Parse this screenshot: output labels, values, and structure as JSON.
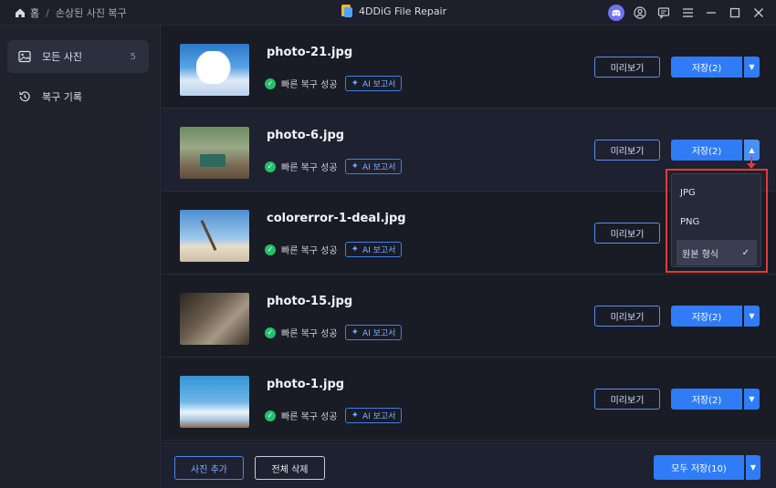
{
  "breadcrumb": {
    "home": "홈",
    "current": "손상된 사진 복구"
  },
  "app": {
    "title": "4DDiG File Repair"
  },
  "window_icons": [
    "discord-icon",
    "account-icon",
    "feedback-icon",
    "menu-icon",
    "minimize-icon",
    "maximize-icon",
    "close-icon"
  ],
  "sidebar": {
    "items": [
      {
        "label": "모든 사진",
        "count": "5",
        "icon": "image-icon",
        "active": true
      },
      {
        "label": "복구 기록",
        "icon": "history-icon",
        "active": false
      }
    ]
  },
  "photos": [
    {
      "name": "photo-21.jpg",
      "status": "빠른 복구 성공",
      "ai_label": "AI 보고서",
      "preview_label": "미리보기",
      "save_label": "저장(2)"
    },
    {
      "name": "photo-6.jpg",
      "status": "빠른 복구 성공",
      "ai_label": "AI 보고서",
      "preview_label": "미리보기",
      "save_label": "저장(2)"
    },
    {
      "name": "colorerror-1-deal.jpg",
      "status": "빠른 복구 성공",
      "ai_label": "AI 보고서",
      "preview_label": "미리보기",
      "save_label": ""
    },
    {
      "name": "photo-15.jpg",
      "status": "빠른 복구 성공",
      "ai_label": "AI 보고서",
      "preview_label": "미리보기",
      "save_label": "저장(2)"
    },
    {
      "name": "photo-1.jpg",
      "status": "빠른 복구 성공",
      "ai_label": "AI 보고서",
      "preview_label": "미리보기",
      "save_label": "저장(2)"
    }
  ],
  "format_dropdown": {
    "options": [
      "JPG",
      "PNG",
      "원본 형식"
    ],
    "selected": "원본 형식"
  },
  "footer": {
    "add_label": "사진 추가",
    "delete_label": "전체 삭제",
    "save_all_label": "모두 저장(10)"
  },
  "colors": {
    "accent": "#2f7cf6",
    "success": "#25c06a",
    "highlight": "#e33b36"
  }
}
